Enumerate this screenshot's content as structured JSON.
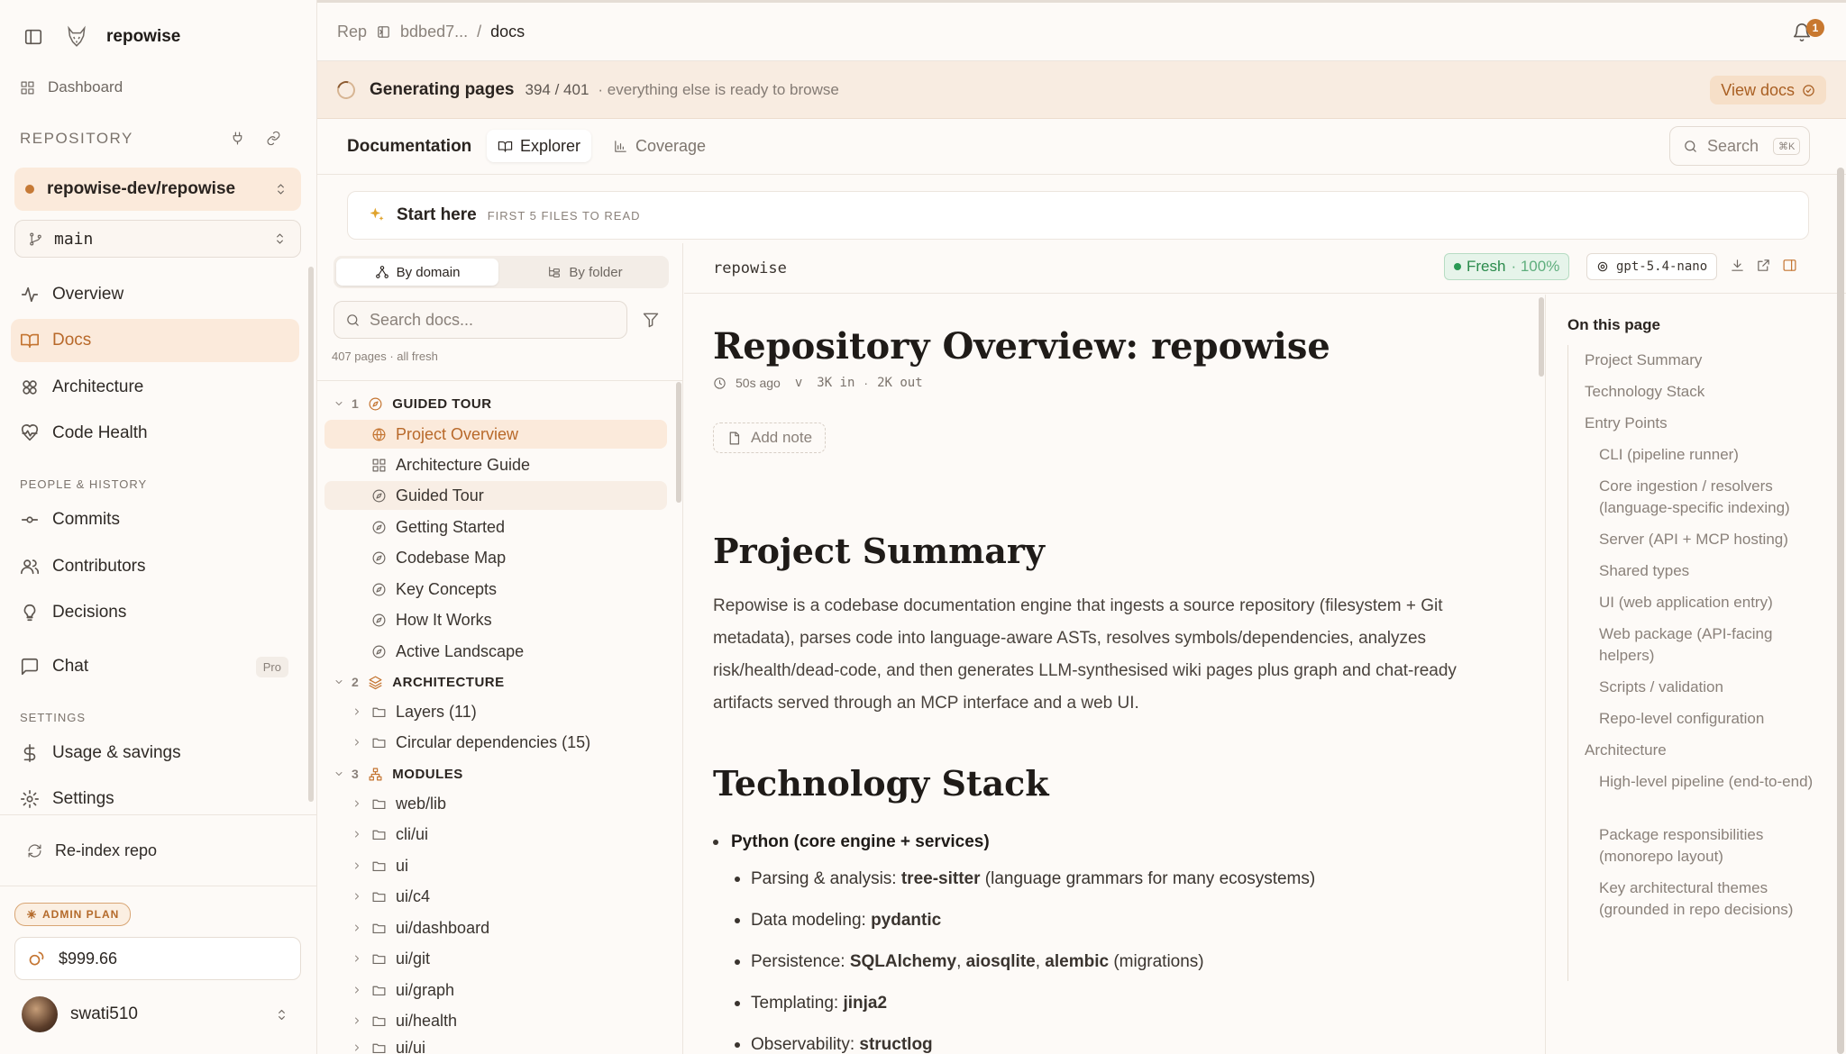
{
  "app": {
    "name": "repowise"
  },
  "sidebar": {
    "dashboard": "Dashboard",
    "repository_label": "REPOSITORY",
    "repo": "repowise-dev/repowise",
    "branch": "main",
    "nav": [
      "Overview",
      "Docs",
      "Architecture",
      "Code Health"
    ],
    "people_label": "PEOPLE & HISTORY",
    "people": [
      "Commits",
      "Contributors",
      "Decisions"
    ],
    "chat": "Chat",
    "chat_badge": "Pro",
    "settings_label": "SETTINGS",
    "settings": [
      "Usage & savings",
      "Settings"
    ],
    "reindex": "Re-index repo",
    "plan": "ADMIN PLAN",
    "balance": "$999.66",
    "user": "swati510"
  },
  "topbar": {
    "crumb_rep": "Rep",
    "crumb_hash": "bdbed7...",
    "crumb_sep": "/",
    "crumb_current": "docs",
    "notifications": "1"
  },
  "banner": {
    "title": "Generating pages",
    "count": "394 / 401",
    "note": "· everything else is ready to browse",
    "action": "View docs"
  },
  "tabs": {
    "title": "Documentation",
    "items": [
      "Explorer",
      "Coverage"
    ],
    "search": "Search",
    "shortcut": "⌘K"
  },
  "start_here": {
    "title": "Start here",
    "subtitle": "FIRST 5 FILES TO READ"
  },
  "tree": {
    "by_domain": "By domain",
    "by_folder": "By folder",
    "search_placeholder": "Search docs...",
    "pages_note": "407 pages · all fresh",
    "groups": [
      {
        "num": "1",
        "name": "GUIDED TOUR",
        "items": [
          "Project Overview",
          "Architecture Guide",
          "Guided Tour",
          "Getting Started",
          "Codebase Map",
          "Key Concepts",
          "How It Works",
          "Active Landscape"
        ]
      },
      {
        "num": "2",
        "name": "ARCHITECTURE",
        "items": [
          "Layers (11)",
          "Circular dependencies (15)"
        ]
      },
      {
        "num": "3",
        "name": "MODULES",
        "items": [
          "web/lib",
          "cli/ui",
          "ui",
          "ui/c4",
          "ui/dashboard",
          "ui/git",
          "ui/graph",
          "ui/health",
          "ui/ui"
        ]
      }
    ]
  },
  "content": {
    "crumb": "repowise",
    "fresh": "Fresh",
    "fresh_pct": "· 100%",
    "model": "gpt-5.4-nano",
    "title": "Repository Overview: repowise",
    "meta": {
      "time": "50s ago",
      "v": "v",
      "tokens_in": "3K in",
      "sep": "·",
      "tokens_out": "2K out"
    },
    "add_note": "Add note",
    "h2_summary": "Project Summary",
    "summary": "Repowise is a codebase documentation engine that ingests a source repository (filesystem + Git metadata), parses code into language-aware ASTs, resolves symbols/dependencies, analyzes risk/health/dead-code, and then generates LLM-synthesised wiki pages plus graph and chat-ready artifacts served through an MCP interface and a web UI.",
    "h2_stack": "Technology Stack",
    "stack_head": "Python (core engine + services)",
    "stack": [
      {
        "pre": "Parsing & analysis: ",
        "bold": "tree-sitter",
        "post": " (language grammars for many ecosystems)"
      },
      {
        "pre": "Data modeling: ",
        "bold": "pydantic",
        "post": ""
      },
      {
        "pre": "Persistence: ",
        "bold": "SQLAlchemy",
        "mid1": ", ",
        "bold2": "aiosqlite",
        "mid2": ", ",
        "bold3": "alembic",
        "post": " (migrations)"
      },
      {
        "pre": "Templating: ",
        "bold": "jinja2",
        "post": ""
      },
      {
        "pre": "Observability: ",
        "bold": "structlog",
        "post": ""
      }
    ]
  },
  "toc": {
    "title": "On this page",
    "items": [
      {
        "label": "Project Summary",
        "level": 1
      },
      {
        "label": "Technology Stack",
        "level": 1
      },
      {
        "label": "Entry Points",
        "level": 1
      },
      {
        "label": "CLI (pipeline runner)",
        "level": 2
      },
      {
        "label": "Core ingestion / resolvers (language-specific indexing)",
        "level": 2
      },
      {
        "label": "Server (API + MCP hosting)",
        "level": 2
      },
      {
        "label": "Shared types",
        "level": 2
      },
      {
        "label": "UI (web application entry)",
        "level": 2
      },
      {
        "label": "Web package (API-facing helpers)",
        "level": 2
      },
      {
        "label": "Scripts / validation",
        "level": 2
      },
      {
        "label": "Repo-level configuration",
        "level": 2
      },
      {
        "label": "Architecture",
        "level": 1
      },
      {
        "label": "High-level pipeline (end-to-end)",
        "level": 2
      },
      {
        "label": "Package responsibilities (monorepo layout)",
        "level": 2
      },
      {
        "label": "Key architectural themes (grounded in repo decisions)",
        "level": 2
      }
    ]
  }
}
